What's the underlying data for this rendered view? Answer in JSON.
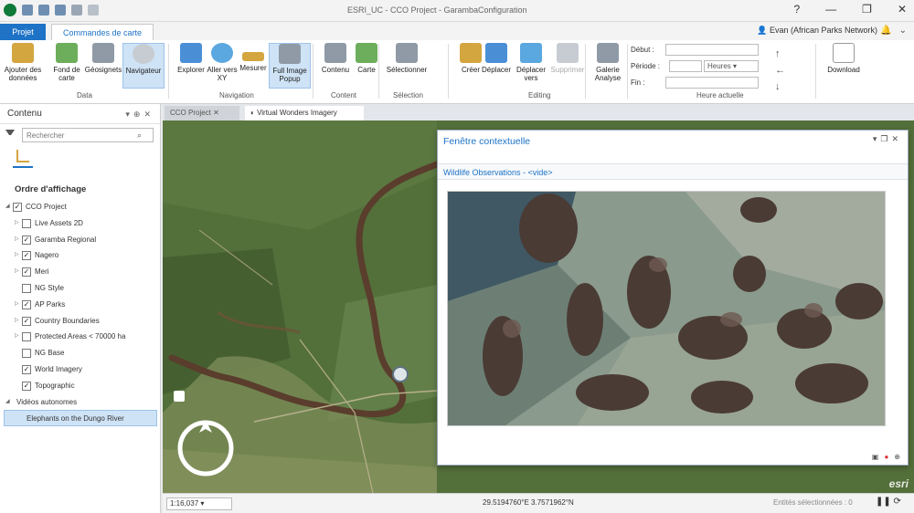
{
  "window": {
    "title": "ESRI_UC - CCO Project - GarambaConfiguration",
    "minimize": "—",
    "maximize": "❐",
    "close": "✕"
  },
  "tabs": {
    "projet": "Projet",
    "commandes": "Commandes de carte"
  },
  "user": {
    "name": "Evan (African Parks Network)"
  },
  "ribbon": {
    "data_group": "Data",
    "navigation_group": "Navigation",
    "content_group": "Content",
    "selection_group": "Sélection",
    "editing_group": "Editing",
    "time_group": "Heure actuelle",
    "buttons": {
      "add_data": "Ajouter des données",
      "basemap": "Fond de carte",
      "geosignets": "Géosignets",
      "navigator": "Navigateur",
      "explore": "Explorer",
      "goto_xy": "Aller vers XY",
      "measure": "Mesurer",
      "full_image": "Full Image Popup",
      "contents": "Contenu",
      "map": "Carte",
      "select": "Sélectionner",
      "create": "Créer",
      "move": "Déplacer",
      "move_vertex": "Déplacer vers",
      "delete": "Supprimer",
      "gallery": "Galerie Analyse",
      "download": "Download"
    },
    "time": {
      "start_label": "Début :",
      "period_label": "Période :",
      "end_label": "Fin :",
      "unit": "Heures"
    }
  },
  "contents": {
    "title": "Contenu",
    "search_placeholder": "Rechercher",
    "order_title": "Ordre d'affichage",
    "layers": [
      {
        "label": "CCO Project",
        "checked": true,
        "indent": 0,
        "expand": "◢"
      },
      {
        "label": "Live Assets 2D",
        "checked": false,
        "indent": 1,
        "expand": "▷"
      },
      {
        "label": "Garamba Regional",
        "checked": true,
        "indent": 1,
        "expand": "▷"
      },
      {
        "label": "Nagero",
        "checked": true,
        "indent": 1,
        "expand": "▷"
      },
      {
        "label": "Meri",
        "checked": true,
        "indent": 1,
        "expand": "▷"
      },
      {
        "label": "NG Style",
        "checked": false,
        "indent": 1,
        "expand": ""
      },
      {
        "label": "AP Parks",
        "checked": true,
        "indent": 1,
        "expand": "▷"
      },
      {
        "label": "Country Boundaries",
        "checked": true,
        "indent": 1,
        "expand": "▷"
      },
      {
        "label": "Protected Areas < 70000 ha",
        "checked": false,
        "indent": 1,
        "expand": "▷"
      },
      {
        "label": "NG Base",
        "checked": false,
        "indent": 1,
        "expand": ""
      },
      {
        "label": "World Imagery",
        "checked": true,
        "indent": 1,
        "expand": ""
      },
      {
        "label": "Topographic",
        "checked": true,
        "indent": 1,
        "expand": ""
      },
      {
        "label": "Vidéos autonomes",
        "checked": null,
        "indent": 0,
        "expand": "◢"
      },
      {
        "label": "Elephants on the Dungo River",
        "checked": null,
        "indent": 1,
        "expand": "",
        "selected": true
      }
    ]
  },
  "map_tabs": {
    "project": "CCO Project",
    "imagery": "Virtual Wonders Imagery"
  },
  "popup": {
    "title": "Fenêtre contextuelle",
    "subtitle": "Wildlife Observations - <vide>"
  },
  "status": {
    "scale": "1:16,037",
    "coords": "29.5194760°E 3.7571962°N",
    "selected": "Entités sélectionnées : 0",
    "logo": "esri"
  },
  "colors": {
    "accent": "#1e73c6",
    "map_green": "#4e6a36"
  }
}
